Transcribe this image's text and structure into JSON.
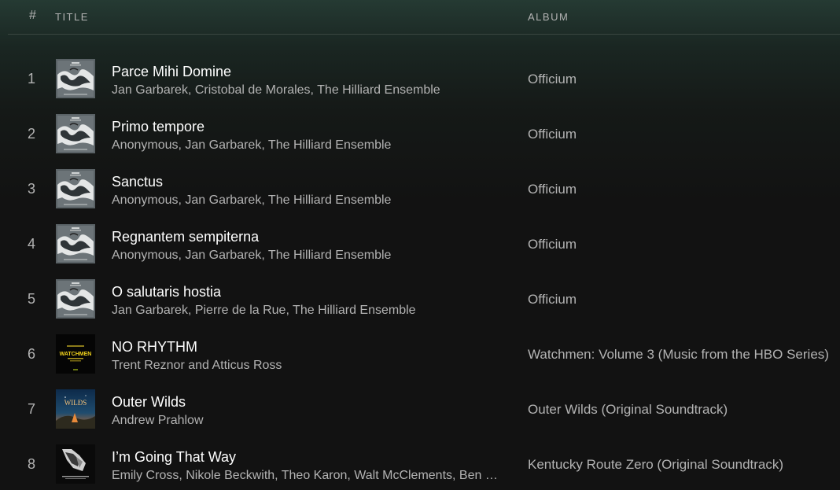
{
  "header": {
    "hash": "#",
    "title_label": "TITLE",
    "album_label": "ALBUM"
  },
  "tracks": [
    {
      "number": "1",
      "title": "Parce Mihi Domine",
      "artists": "Jan Garbarek, Cristobal de Morales, The Hilliard Ensemble",
      "album": "Officium",
      "cover": "officium"
    },
    {
      "number": "2",
      "title": "Primo tempore",
      "artists": "Anonymous, Jan Garbarek, The Hilliard Ensemble",
      "album": "Officium",
      "cover": "officium"
    },
    {
      "number": "3",
      "title": "Sanctus",
      "artists": "Anonymous, Jan Garbarek, The Hilliard Ensemble",
      "album": "Officium",
      "cover": "officium"
    },
    {
      "number": "4",
      "title": "Regnantem sempiterna",
      "artists": "Anonymous, Jan Garbarek, The Hilliard Ensemble",
      "album": "Officium",
      "cover": "officium"
    },
    {
      "number": "5",
      "title": "O salutaris hostia",
      "artists": "Jan Garbarek, Pierre de la Rue, The Hilliard Ensemble",
      "album": "Officium",
      "cover": "officium"
    },
    {
      "number": "6",
      "title": "NO RHYTHM",
      "artists": "Trent Reznor and Atticus Ross",
      "album": "Watchmen: Volume 3 (Music from the HBO Series)",
      "cover": "watchmen",
      "cover_text": "WATCHMEN"
    },
    {
      "number": "7",
      "title": "Outer Wilds",
      "artists": "Andrew Prahlow",
      "album": "Outer Wilds (Original Soundtrack)",
      "cover": "outer-wilds",
      "cover_text": "WILDS"
    },
    {
      "number": "8",
      "title": "I’m Going That Way",
      "artists": "Emily Cross, Nikole Beckwith, Theo Karon, Walt McClements, Ben Babbitt",
      "album": "Kentucky Route Zero (Original Soundtrack)",
      "cover": "kentucky-route-zero"
    }
  ]
}
